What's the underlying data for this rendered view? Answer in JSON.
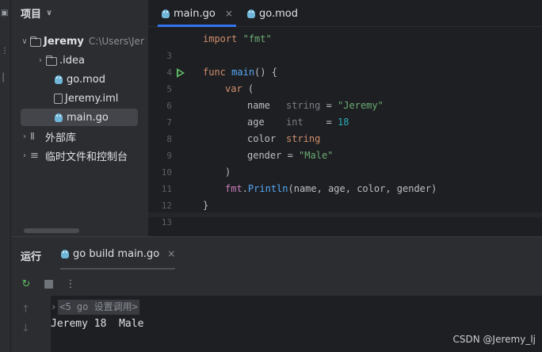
{
  "project_panel": {
    "title": "项目",
    "tree": [
      {
        "label": "Jeremy",
        "path": "C:\\Users\\Jer",
        "icon": "folder-icon",
        "expanded": true
      },
      {
        "label": ".idea",
        "icon": "folder-icon",
        "expanded": false
      },
      {
        "label": "go.mod",
        "icon": "go-file-icon"
      },
      {
        "label": "Jeremy.iml",
        "icon": "file-icon"
      },
      {
        "label": "main.go",
        "icon": "go-file-icon",
        "selected": true
      },
      {
        "label": "外部库",
        "icon": "library-icon",
        "expanded": false
      },
      {
        "label": "临时文件和控制台",
        "icon": "scratches-icon",
        "expanded": false
      }
    ]
  },
  "editor": {
    "tabs": [
      {
        "label": "main.go",
        "active": true,
        "close": "×"
      },
      {
        "label": "go.mod",
        "active": false
      }
    ],
    "line_numbers": [
      "3",
      "4",
      "5",
      "6",
      "7",
      "8",
      "9",
      "10",
      "11",
      "12",
      "13"
    ],
    "code": {
      "l3_kw": "import",
      "l3_str": "\"fmt\"",
      "l5_kw": "func",
      "l5_fn": "main",
      "l5_rest": "() {",
      "l6_kw": "var",
      "l6_rest": " (",
      "l7_name": "name",
      "l7_type": "string",
      "l7_eq": " = ",
      "l7_val": "\"Jeremy\"",
      "l8_name": "age",
      "l8_type": "int",
      "l8_eq": "    = ",
      "l8_val": "18",
      "l9_name": "color",
      "l9_type": "string",
      "l10_name": "gender",
      "l10_eq": " = ",
      "l10_val": "\"Male\"",
      "l11": ")",
      "l12_pkg": "fmt",
      "l12_dot": ".",
      "l12_fn": "Println",
      "l12_args": "(name, age, color, gender)",
      "l13": "}"
    }
  },
  "run_panel": {
    "title": "运行",
    "tab_label": "go build main.go",
    "tab_close": "×",
    "console_header": "<5 go 设置调用>",
    "console_output": "Jeremy 18  Male"
  },
  "watermark": "CSDN @Jeremy_lj",
  "colors": {
    "keyword": "#cf8e6d",
    "string": "#6aab73",
    "number": "#2aacb8",
    "function": "#56a8f5",
    "accent": "#3574f0",
    "run": "#5fb865"
  }
}
